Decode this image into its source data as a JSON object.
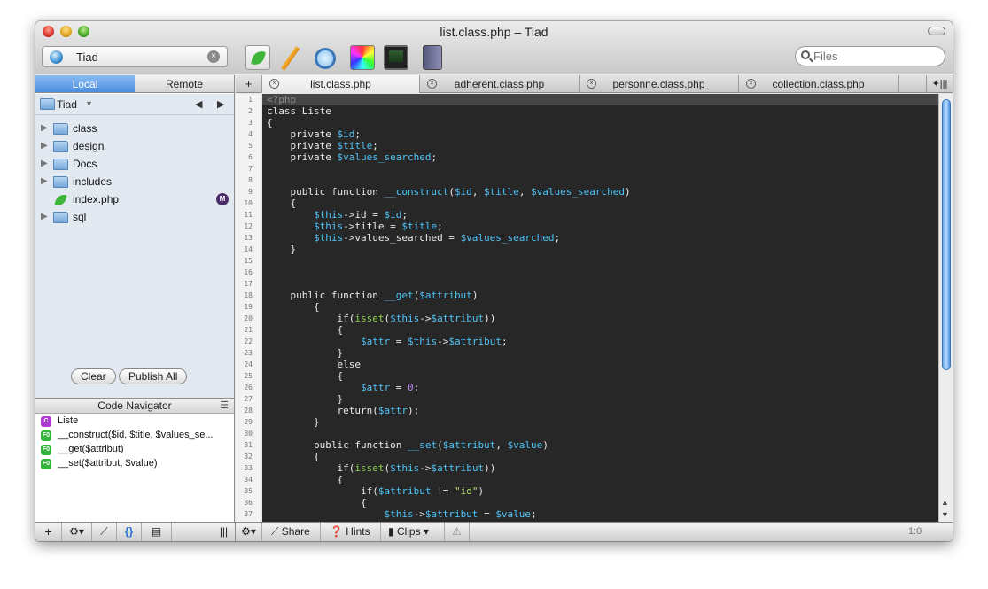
{
  "window": {
    "title": "list.class.php – Tiad"
  },
  "site": {
    "name": "Tiad"
  },
  "search": {
    "placeholder": "Files"
  },
  "sidebar": {
    "tabs": [
      "Local",
      "Remote"
    ],
    "root": "Tiad",
    "items": [
      {
        "name": "class",
        "type": "folder"
      },
      {
        "name": "design",
        "type": "folder"
      },
      {
        "name": "Docs",
        "type": "folder"
      },
      {
        "name": "includes",
        "type": "folder"
      },
      {
        "name": "index.php",
        "type": "file",
        "badge": "M"
      },
      {
        "name": "sql",
        "type": "folder"
      }
    ],
    "clear_label": "Clear",
    "publish_label": "Publish All"
  },
  "navigator": {
    "title": "Code Navigator",
    "items": [
      {
        "icon": "C",
        "label": "Liste"
      },
      {
        "icon": "F0",
        "label": "__construct($id, $title, $values_se..."
      },
      {
        "icon": "F0",
        "label": "__get($attribut)"
      },
      {
        "icon": "F0",
        "label": "__set($attribut, $value)"
      }
    ]
  },
  "tabs": [
    {
      "label": "list.class.php",
      "active": true
    },
    {
      "label": "adherent.class.php"
    },
    {
      "label": "personne.class.php"
    },
    {
      "label": "collection.class.php"
    }
  ],
  "editor": {
    "lines": [
      "<?php",
      "class Liste",
      "{",
      "    private $id;",
      "    private $title;",
      "    private $values_searched;",
      "",
      "",
      "    public function __construct($id, $title, $values_searched)",
      "    {",
      "        $this->id = $id;",
      "        $this->title = $title;",
      "        $this->values_searched = $values_searched;",
      "    }",
      "",
      "",
      "",
      "    public function __get($attribut)",
      "        {",
      "            if(isset($this->$attribut))",
      "            {",
      "                $attr = $this->$attribut;",
      "            }",
      "            else",
      "            {",
      "                $attr = 0;",
      "            }",
      "            return($attr);",
      "        }",
      "",
      "        public function __set($attribut, $value)",
      "        {",
      "            if(isset($this->$attribut))",
      "            {",
      "                if($attribut != \"id\")",
      "                {",
      "                    $this->$attribut = $value;"
    ]
  },
  "bottombar": {
    "share": "Share",
    "hints": "Hints",
    "clips": "Clips",
    "position": "1:0"
  },
  "colors": {
    "variable": "#4fc3f7",
    "function": "#4fc3f7",
    "string": "#b6e07a",
    "number": "#c78cff",
    "keyword_green": "#8fd14f"
  }
}
